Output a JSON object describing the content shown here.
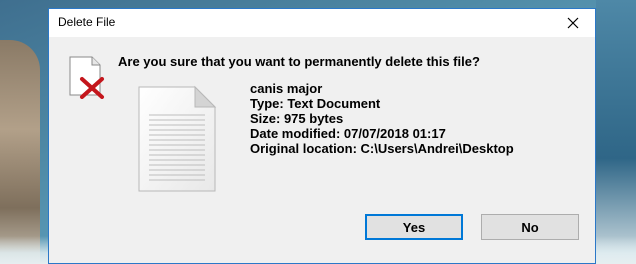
{
  "dialog": {
    "title": "Delete File",
    "question": "Are you sure that you want to permanently delete this file?",
    "details": {
      "name": "canis major",
      "type": "Type: Text Document",
      "size": "Size: 975 bytes",
      "modified": "Date modified: 07/07/2018 01:17",
      "location": "Original location: C:\\Users\\Andrei\\Desktop"
    },
    "buttons": {
      "yes": "Yes",
      "no": "No",
      "default": "yes"
    },
    "icons": {
      "warning": "delete-warning-icon",
      "file": "text-document-icon",
      "close": "close-icon"
    },
    "colors": {
      "accent_border": "#2b78c8",
      "default_button_border": "#0078d7",
      "delete_cross": "#c4161c"
    }
  }
}
